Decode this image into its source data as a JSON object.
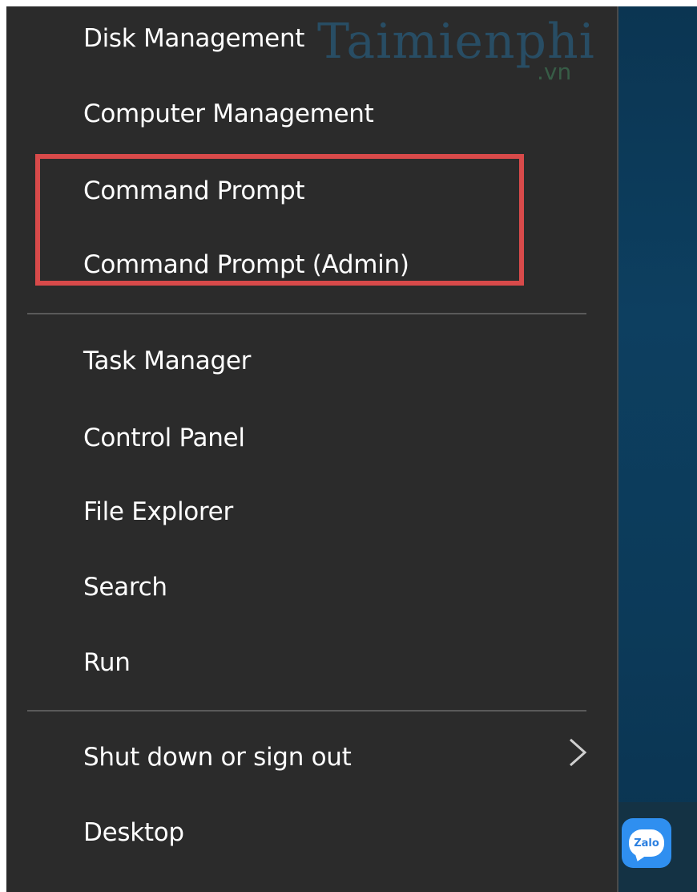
{
  "watermark": {
    "brand": "Taimienphi",
    "suffix": ".vn"
  },
  "menu": {
    "items": [
      {
        "label": "Disk Management"
      },
      {
        "label": "Computer Management"
      },
      {
        "label": "Command Prompt"
      },
      {
        "label": "Command Prompt (Admin)"
      },
      {
        "label": "Task Manager"
      },
      {
        "label": "Control Panel"
      },
      {
        "label": "File Explorer"
      },
      {
        "label": "Search"
      },
      {
        "label": "Run"
      },
      {
        "label": "Shut down or sign out"
      },
      {
        "label": "Desktop"
      }
    ]
  },
  "taskbar": {
    "zalo_label": "Zalo"
  },
  "colors": {
    "menu_bg": "#2b2b2b",
    "text": "#ffffff",
    "highlight": "#d84a4a",
    "desktop": "#0d3f60"
  }
}
